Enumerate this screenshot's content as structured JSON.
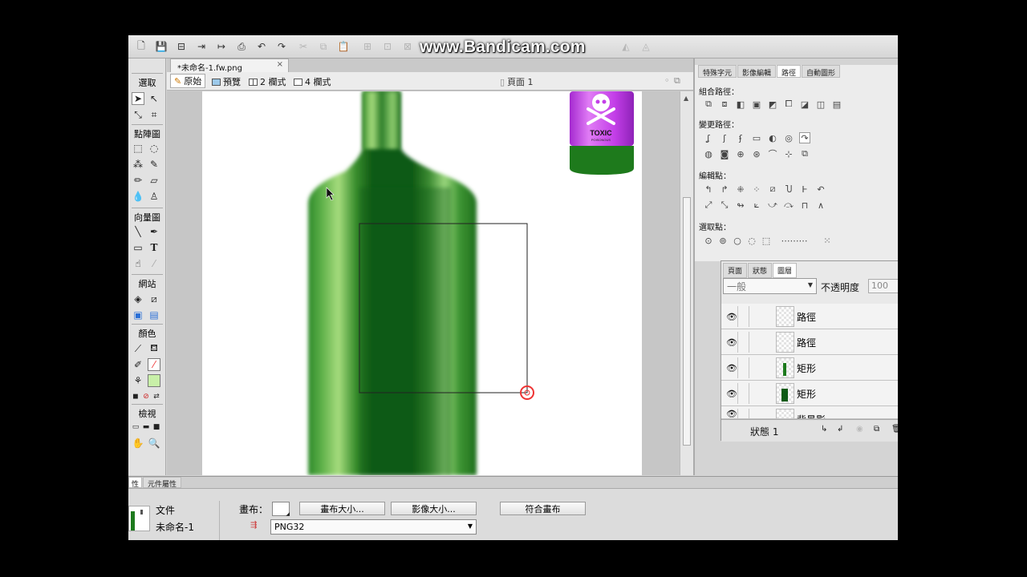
{
  "watermark": "www.Bandicam.com",
  "document": {
    "tab_title": "*未命名-1.fw.png",
    "close": "×"
  },
  "view_modes": {
    "original": "原始",
    "preview": "預覽",
    "two_up": "2 欄式",
    "four_up": "4 欄式"
  },
  "page": {
    "label": "頁面 1"
  },
  "tools": {
    "sections": {
      "select": "選取",
      "bitmap": "點陣圖",
      "vector": "向量圖",
      "web": "網站",
      "colors": "顏色",
      "view": "檢視"
    },
    "text_tool": "T"
  },
  "bottle_label": {
    "line1": "TOXIC",
    "line2": "POISONOUS"
  },
  "path_panel": {
    "tabs": [
      "特殊字元",
      "影像編輯",
      "路徑",
      "自動圖形"
    ],
    "active_tab": "路徑",
    "combine_label": "組合路徑：",
    "alter_label": "變更路徑：",
    "edit_points_label": "編輯點：",
    "select_points_label": "選取點："
  },
  "layers_panel": {
    "tabs": [
      "頁面",
      "狀態",
      "圖層"
    ],
    "active_tab": "圖層",
    "blend_mode": "一般",
    "opacity_label": "不透明度",
    "opacity_value": "100",
    "rows": [
      {
        "name": "路徑"
      },
      {
        "name": "路徑"
      },
      {
        "name": "矩形"
      },
      {
        "name": "矩形"
      },
      {
        "name": "背景影"
      }
    ],
    "state_label": "狀態  1"
  },
  "properties": {
    "tabs": [
      "性",
      "元件屬性"
    ],
    "doc_type": "文件",
    "doc_name": "未命名-1",
    "canvas_label": "畫布：",
    "canvas_size_btn": "畫布大小...",
    "image_size_btn": "影像大小...",
    "fit_canvas_btn": "符合畫布",
    "format": "PNG32"
  },
  "colors": {
    "bottle_dark": "#0d5a16",
    "bottle_light": "#a6dc7d",
    "label_magenta": "#c33ee8",
    "accent_red": "#e33"
  }
}
